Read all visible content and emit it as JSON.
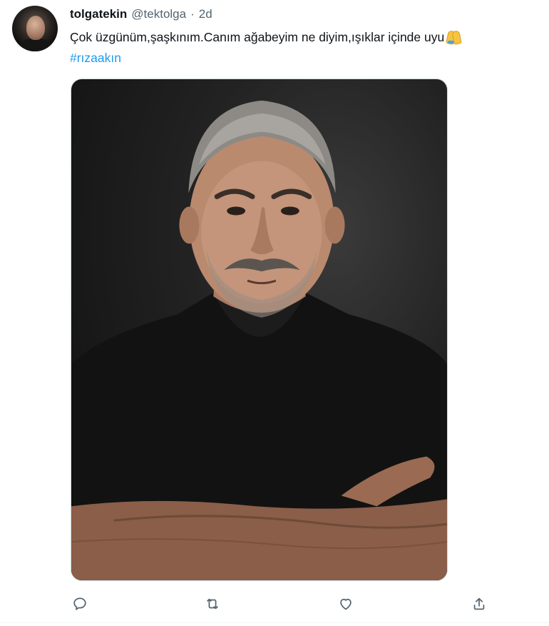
{
  "tweet": {
    "display_name": "tolgatekin",
    "handle": "@tektolga",
    "separator": "·",
    "time": "2d",
    "text": "Çok üzgünüm,şaşkınım.Canım ağabeyim ne diyim,ışıklar içinde uyu",
    "emoji": "folded-hands",
    "hashtag": "#rızaakın"
  },
  "actions": {
    "reply_icon": "reply-icon",
    "retweet_icon": "retweet-icon",
    "like_icon": "heart-icon",
    "share_icon": "share-icon"
  },
  "colors": {
    "link": "#1d9bf0",
    "secondary_text": "#536471",
    "primary_text": "#0f1419"
  }
}
